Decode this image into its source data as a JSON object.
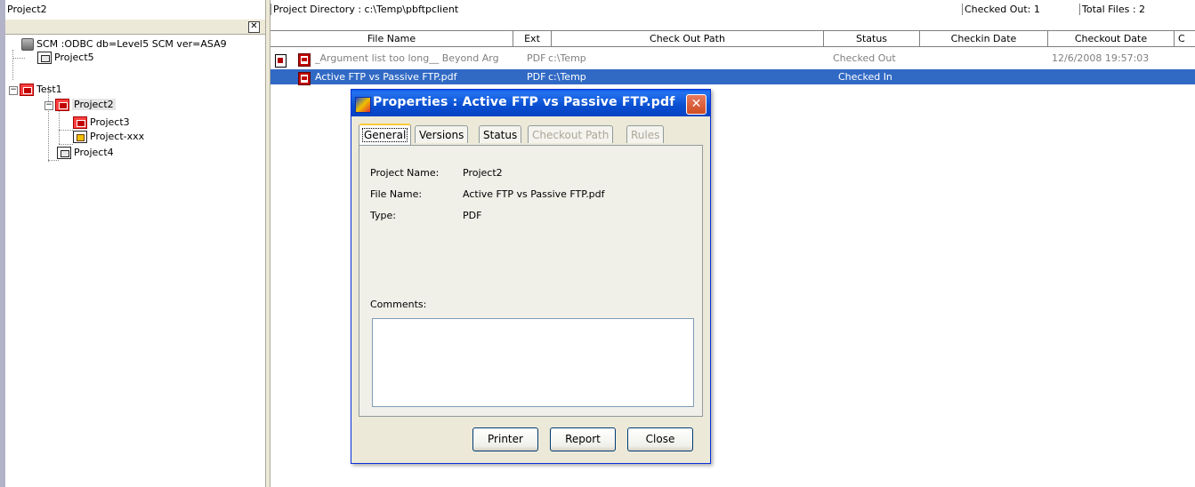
{
  "left_pane": {
    "title": "Project2",
    "tree": [
      {
        "label": "SCM :ODBC db=Level5 SCM ver=ASA9",
        "icon": "database-icon"
      },
      {
        "label": "Project5",
        "icon": "project-icon"
      },
      {
        "label": "Test1",
        "icon": "project-red-icon"
      },
      {
        "label": "Project2",
        "icon": "project-red-icon",
        "selected": true
      },
      {
        "label": "Project3",
        "icon": "project-red-icon"
      },
      {
        "label": "Project-xxx",
        "icon": "project-locked-icon"
      },
      {
        "label": "Project4",
        "icon": "project-icon"
      }
    ],
    "close_glyph": "✕"
  },
  "status": {
    "project_directory": "Project Directory : c:\\Temp\\pbftpclient",
    "checked_out": "Checked Out: 1",
    "total_files": "Total Files : 2"
  },
  "grid": {
    "columns": [
      "File Name",
      "Ext",
      "Check Out Path",
      "Status",
      "Checkin Date",
      "Checkout Date",
      "C"
    ],
    "rows": [
      {
        "file_name": "_Argument list too long__ Beyond Arg",
        "ext": "PDF",
        "path": "c:\\Temp",
        "status": "Checked Out",
        "checkin_date": "",
        "checkout_date": "12/6/2008 19:57:03",
        "selected": false
      },
      {
        "file_name": "Active FTP vs Passive FTP.pdf",
        "ext": "PDF",
        "path": "c:\\Temp",
        "status": "Checked In",
        "checkin_date": "",
        "checkout_date": "",
        "selected": true
      }
    ]
  },
  "dialog": {
    "title": "Properties : Active FTP vs Passive FTP.pdf",
    "tabs": [
      {
        "label": "General",
        "active": true,
        "enabled": true
      },
      {
        "label": "Versions",
        "active": false,
        "enabled": true
      },
      {
        "label": "Status",
        "active": false,
        "enabled": true
      },
      {
        "label": "Checkout Path",
        "active": false,
        "enabled": false
      },
      {
        "label": "Rules",
        "active": false,
        "enabled": false
      }
    ],
    "properties": {
      "project_name_label": "Project Name:",
      "project_name_value": "Project2",
      "file_name_label": "File Name:",
      "file_name_value": "Active FTP vs Passive FTP.pdf",
      "type_label": "Type:",
      "type_value": "PDF",
      "comments_label": "Comments:",
      "comments_value": ""
    },
    "buttons": {
      "printer": "Printer",
      "report": "Report",
      "close": "Close"
    }
  }
}
